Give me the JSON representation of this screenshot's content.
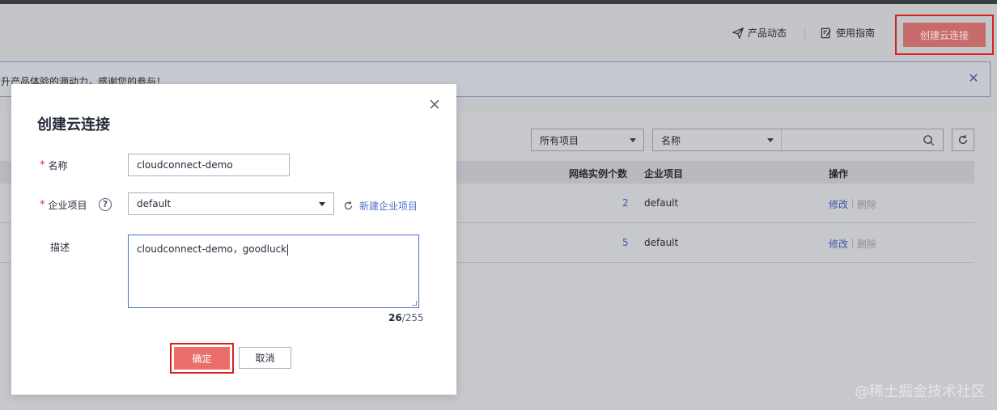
{
  "header": {
    "product_news": "产品动态",
    "user_guide": "使用指南",
    "create_button": "创建云连接"
  },
  "banner": {
    "text": "升产品体验的源动力，感谢您的参与！",
    "close_icon": "close-icon"
  },
  "toolbar": {
    "project_select": "所有项目",
    "filter_select": "名称",
    "search_placeholder": ""
  },
  "table": {
    "headers": {
      "instances": "网络实例个数",
      "project": "企业项目",
      "actions": "操作"
    },
    "rows": [
      {
        "instances": "2",
        "project": "default",
        "modify": "修改",
        "delete": "删除"
      },
      {
        "instances": "5",
        "project": "default",
        "modify": "修改",
        "delete": "删除"
      }
    ]
  },
  "modal": {
    "title": "创建云连接",
    "name_label": "名称",
    "name_value": "cloudconnect-demo",
    "project_label": "企业项目",
    "project_value": "default",
    "new_project_link": "新建企业项目",
    "desc_label": "描述",
    "desc_value": "cloudconnect-demo，goodluck",
    "counter_current": "26",
    "counter_max": "/255",
    "ok_label": "确定",
    "cancel_label": "取消"
  },
  "watermark": "@稀土掘金技术社区",
  "colors": {
    "primary_red": "#ea6f6b",
    "highlight_border": "#d9201d",
    "link_blue": "#526ecc",
    "required_star": "#e0383e"
  }
}
